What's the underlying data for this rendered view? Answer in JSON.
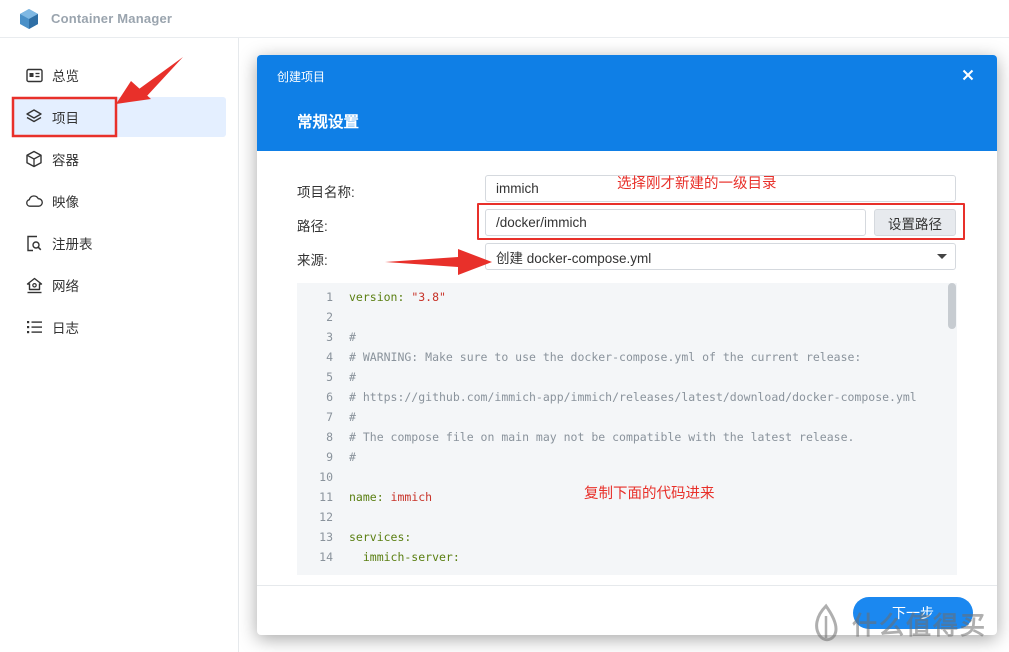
{
  "app": {
    "title": "Container Manager"
  },
  "sidebar": {
    "items": [
      {
        "label": "总览",
        "icon": "overview-icon"
      },
      {
        "label": "项目",
        "icon": "layers-icon",
        "active": true
      },
      {
        "label": "容器",
        "icon": "cube-icon"
      },
      {
        "label": "映像",
        "icon": "cloud-icon"
      },
      {
        "label": "注册表",
        "icon": "registry-search-icon"
      },
      {
        "label": "网络",
        "icon": "network-icon"
      },
      {
        "label": "日志",
        "icon": "list-icon"
      }
    ]
  },
  "dialog": {
    "title": "创建项目",
    "subtitle": "常规设置",
    "fields": {
      "name_label": "项目名称:",
      "name_value": "immich",
      "path_label": "路径:",
      "path_value": "/docker/immich",
      "path_button": "设置路径",
      "source_label": "来源:",
      "source_value": "创建 docker-compose.yml"
    },
    "editor": {
      "lines": [
        {
          "n": "1",
          "segs": [
            {
              "t": "version: ",
              "c": "key"
            },
            {
              "t": "\"3.8\"",
              "c": "str"
            }
          ]
        },
        {
          "n": "2",
          "segs": []
        },
        {
          "n": "3",
          "segs": [
            {
              "t": "#",
              "c": "comment"
            }
          ]
        },
        {
          "n": "4",
          "segs": [
            {
              "t": "# WARNING: Make sure to use the docker-compose.yml of the current release:",
              "c": "comment"
            }
          ]
        },
        {
          "n": "5",
          "segs": [
            {
              "t": "#",
              "c": "comment"
            }
          ]
        },
        {
          "n": "6",
          "segs": [
            {
              "t": "# https://github.com/immich-app/immich/releases/latest/download/docker-compose.yml",
              "c": "comment"
            }
          ]
        },
        {
          "n": "7",
          "segs": [
            {
              "t": "#",
              "c": "comment"
            }
          ]
        },
        {
          "n": "8",
          "segs": [
            {
              "t": "# The compose file on main may not be compatible with the latest release.",
              "c": "comment"
            }
          ]
        },
        {
          "n": "9",
          "segs": [
            {
              "t": "#",
              "c": "comment"
            }
          ]
        },
        {
          "n": "10",
          "segs": []
        },
        {
          "n": "11",
          "segs": [
            {
              "t": "name: ",
              "c": "key"
            },
            {
              "t": "immich",
              "c": "str"
            }
          ]
        },
        {
          "n": "12",
          "segs": []
        },
        {
          "n": "13",
          "segs": [
            {
              "t": "services:",
              "c": "key"
            }
          ]
        },
        {
          "n": "14",
          "segs": [
            {
              "t": "  immich-server:",
              "c": "key"
            }
          ]
        }
      ]
    },
    "next_button": "下一步"
  },
  "annotations": {
    "path_note": "选择刚才新建的一级目录",
    "code_note": "复制下面的代码进来"
  },
  "watermark": {
    "text": "什么值得买"
  },
  "colors": {
    "accent": "#0f7fe6",
    "annotation": "#e8302a"
  }
}
